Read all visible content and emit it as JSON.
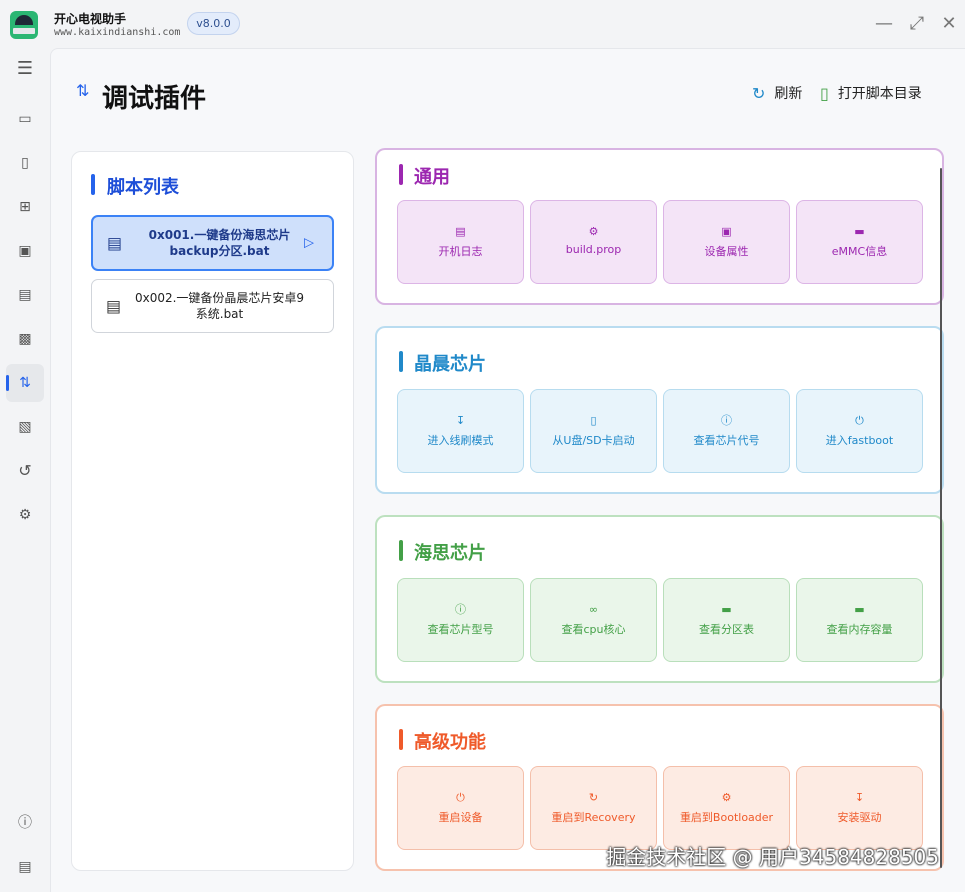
{
  "app": {
    "name": "开心电视助手",
    "url": "www.kaixindianshi.com",
    "version": "v8.0.0"
  },
  "window_controls": {
    "minimize_icon": "minimize-icon",
    "maximize_icon": "maximize-icon",
    "close_icon": "close-icon"
  },
  "sidebar": {
    "items": [
      {
        "icon": "menu-icon"
      },
      {
        "icon": "monitor-icon"
      },
      {
        "icon": "door-icon"
      },
      {
        "icon": "grid-icon"
      },
      {
        "icon": "screen-cast-icon"
      },
      {
        "icon": "image-icon"
      },
      {
        "icon": "laptop-icon"
      },
      {
        "icon": "plugin-icon",
        "active": true
      },
      {
        "icon": "terminal-icon"
      },
      {
        "icon": "history-icon"
      },
      {
        "icon": "settings-icon"
      },
      {
        "icon": "info-icon"
      },
      {
        "icon": "file-icon"
      }
    ]
  },
  "header": {
    "title": "调试插件",
    "refresh_label": "刷新",
    "open_dir_label": "打开脚本目录"
  },
  "script_list": {
    "title": "脚本列表",
    "items": [
      {
        "label": "0x001.一键备份海思芯片backup分区.bat",
        "selected": true
      },
      {
        "label": "0x002.一键备份晶晨芯片安卓9系统.bat",
        "selected": false
      }
    ]
  },
  "sections": [
    {
      "title": "通用",
      "color": "#9c27b0",
      "tiles": [
        {
          "label": "开机日志",
          "icon": "document-icon"
        },
        {
          "label": "build.prop",
          "icon": "gear-icon"
        },
        {
          "label": "设备属性",
          "icon": "device-icon"
        },
        {
          "label": "eMMC信息",
          "icon": "chip-icon"
        }
      ]
    },
    {
      "title": "晶晨芯片",
      "color": "#2089c9",
      "tiles": [
        {
          "label": "进入线刷模式",
          "icon": "download-icon"
        },
        {
          "label": "从U盘/SD卡启动",
          "icon": "usb-icon"
        },
        {
          "label": "查看芯片代号",
          "icon": "info-icon"
        },
        {
          "label": "进入fastboot",
          "icon": "power-icon"
        }
      ]
    },
    {
      "title": "海思芯片",
      "color": "#43a047",
      "tiles": [
        {
          "label": "查看芯片型号",
          "icon": "info-icon"
        },
        {
          "label": "查看cpu核心",
          "icon": "cpu-icon"
        },
        {
          "label": "查看分区表",
          "icon": "partition-icon"
        },
        {
          "label": "查看内存容量",
          "icon": "memory-icon"
        }
      ]
    },
    {
      "title": "高级功能",
      "color": "#ef5a2a",
      "tiles": [
        {
          "label": "重启设备",
          "icon": "power-icon"
        },
        {
          "label": "重启到Recovery",
          "icon": "refresh-icon"
        },
        {
          "label": "重启到Bootloader",
          "icon": "gear-icon"
        },
        {
          "label": "安装驱动",
          "icon": "download-icon"
        }
      ]
    }
  ],
  "watermark": "掘金技术社区 @ 用户34584828505"
}
